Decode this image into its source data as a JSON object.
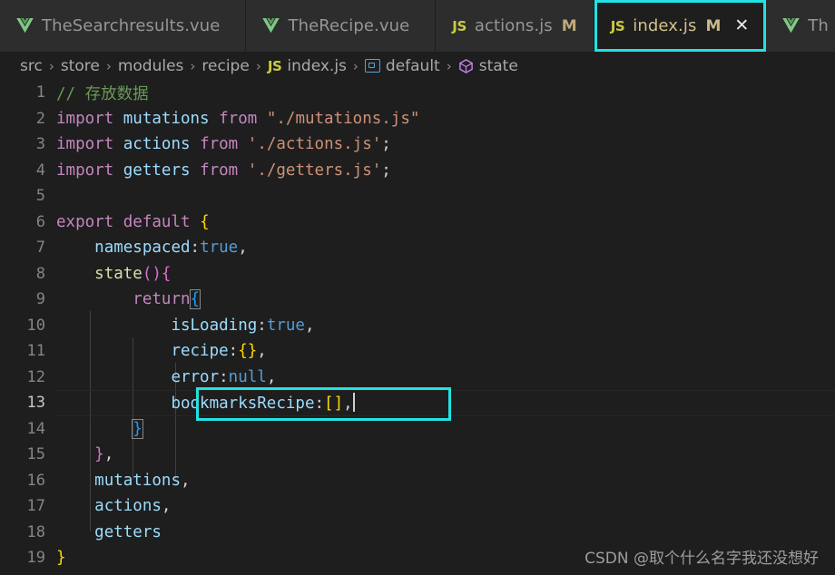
{
  "tabs": [
    {
      "icon": "vue-icon",
      "label": "TheSearchresults.vue",
      "dirty": "",
      "active": false,
      "close": ""
    },
    {
      "icon": "vue-icon",
      "label": "TheRecipe.vue",
      "dirty": "",
      "active": false,
      "close": ""
    },
    {
      "icon": "javascript-icon",
      "label": "actions.js",
      "dirty": "M",
      "active": false,
      "close": ""
    },
    {
      "icon": "javascript-icon",
      "label": "index.js",
      "dirty": "M",
      "active": true,
      "close": "✕"
    },
    {
      "icon": "vue-icon",
      "label": "Th",
      "dirty": "",
      "active": false,
      "close": ""
    }
  ],
  "breadcrumb": {
    "separator": "›",
    "items": [
      {
        "label": "src",
        "icon": ""
      },
      {
        "label": "store",
        "icon": ""
      },
      {
        "label": "modules",
        "icon": ""
      },
      {
        "label": "recipe",
        "icon": ""
      },
      {
        "label": "index.js",
        "icon": "javascript-icon"
      },
      {
        "label": "default",
        "icon": "module-icon"
      },
      {
        "label": "state",
        "icon": "field-cube-icon"
      }
    ]
  },
  "editor": {
    "language": "javascript",
    "cursor_line": 13,
    "lines": [
      {
        "n": "1",
        "text": "// 存放数据"
      },
      {
        "n": "2",
        "text": "import mutations from \"./mutations.js\""
      },
      {
        "n": "3",
        "text": "import actions from './actions.js';"
      },
      {
        "n": "4",
        "text": "import getters from './getters.js';"
      },
      {
        "n": "5",
        "text": ""
      },
      {
        "n": "6",
        "text": "export default {"
      },
      {
        "n": "7",
        "text": "    namespaced:true,"
      },
      {
        "n": "8",
        "text": "    state(){"
      },
      {
        "n": "9",
        "text": "        return{"
      },
      {
        "n": "10",
        "text": "            isLoading:true,"
      },
      {
        "n": "11",
        "text": "            recipe:{},"
      },
      {
        "n": "12",
        "text": "            error:null,"
      },
      {
        "n": "13",
        "text": "            bookmarksRecipe:[],"
      },
      {
        "n": "14",
        "text": "        }"
      },
      {
        "n": "15",
        "text": "    },"
      },
      {
        "n": "16",
        "text": "    mutations,"
      },
      {
        "n": "17",
        "text": "    actions,"
      },
      {
        "n": "18",
        "text": "    getters"
      },
      {
        "n": "19",
        "text": "}"
      }
    ]
  },
  "annotations": {
    "highlight_color": "#22e2e2",
    "tab_highlight_label": "index.js",
    "code_highlight_line": "13"
  },
  "watermark": {
    "text": "CSDN @取个什么名字我还没想好"
  },
  "colors": {
    "editor_background": "#1e1e1e",
    "tab_background": "#2d2d2d",
    "tabbar_background": "#252526",
    "accent": "#22e2e2",
    "comment": "#6a9955",
    "keyword": "#c586c0",
    "identifier": "#9cdcfe",
    "string": "#ce9178",
    "function": "#dcdcaa",
    "constant": "#569cd6",
    "git_modified": "#587c0c"
  }
}
